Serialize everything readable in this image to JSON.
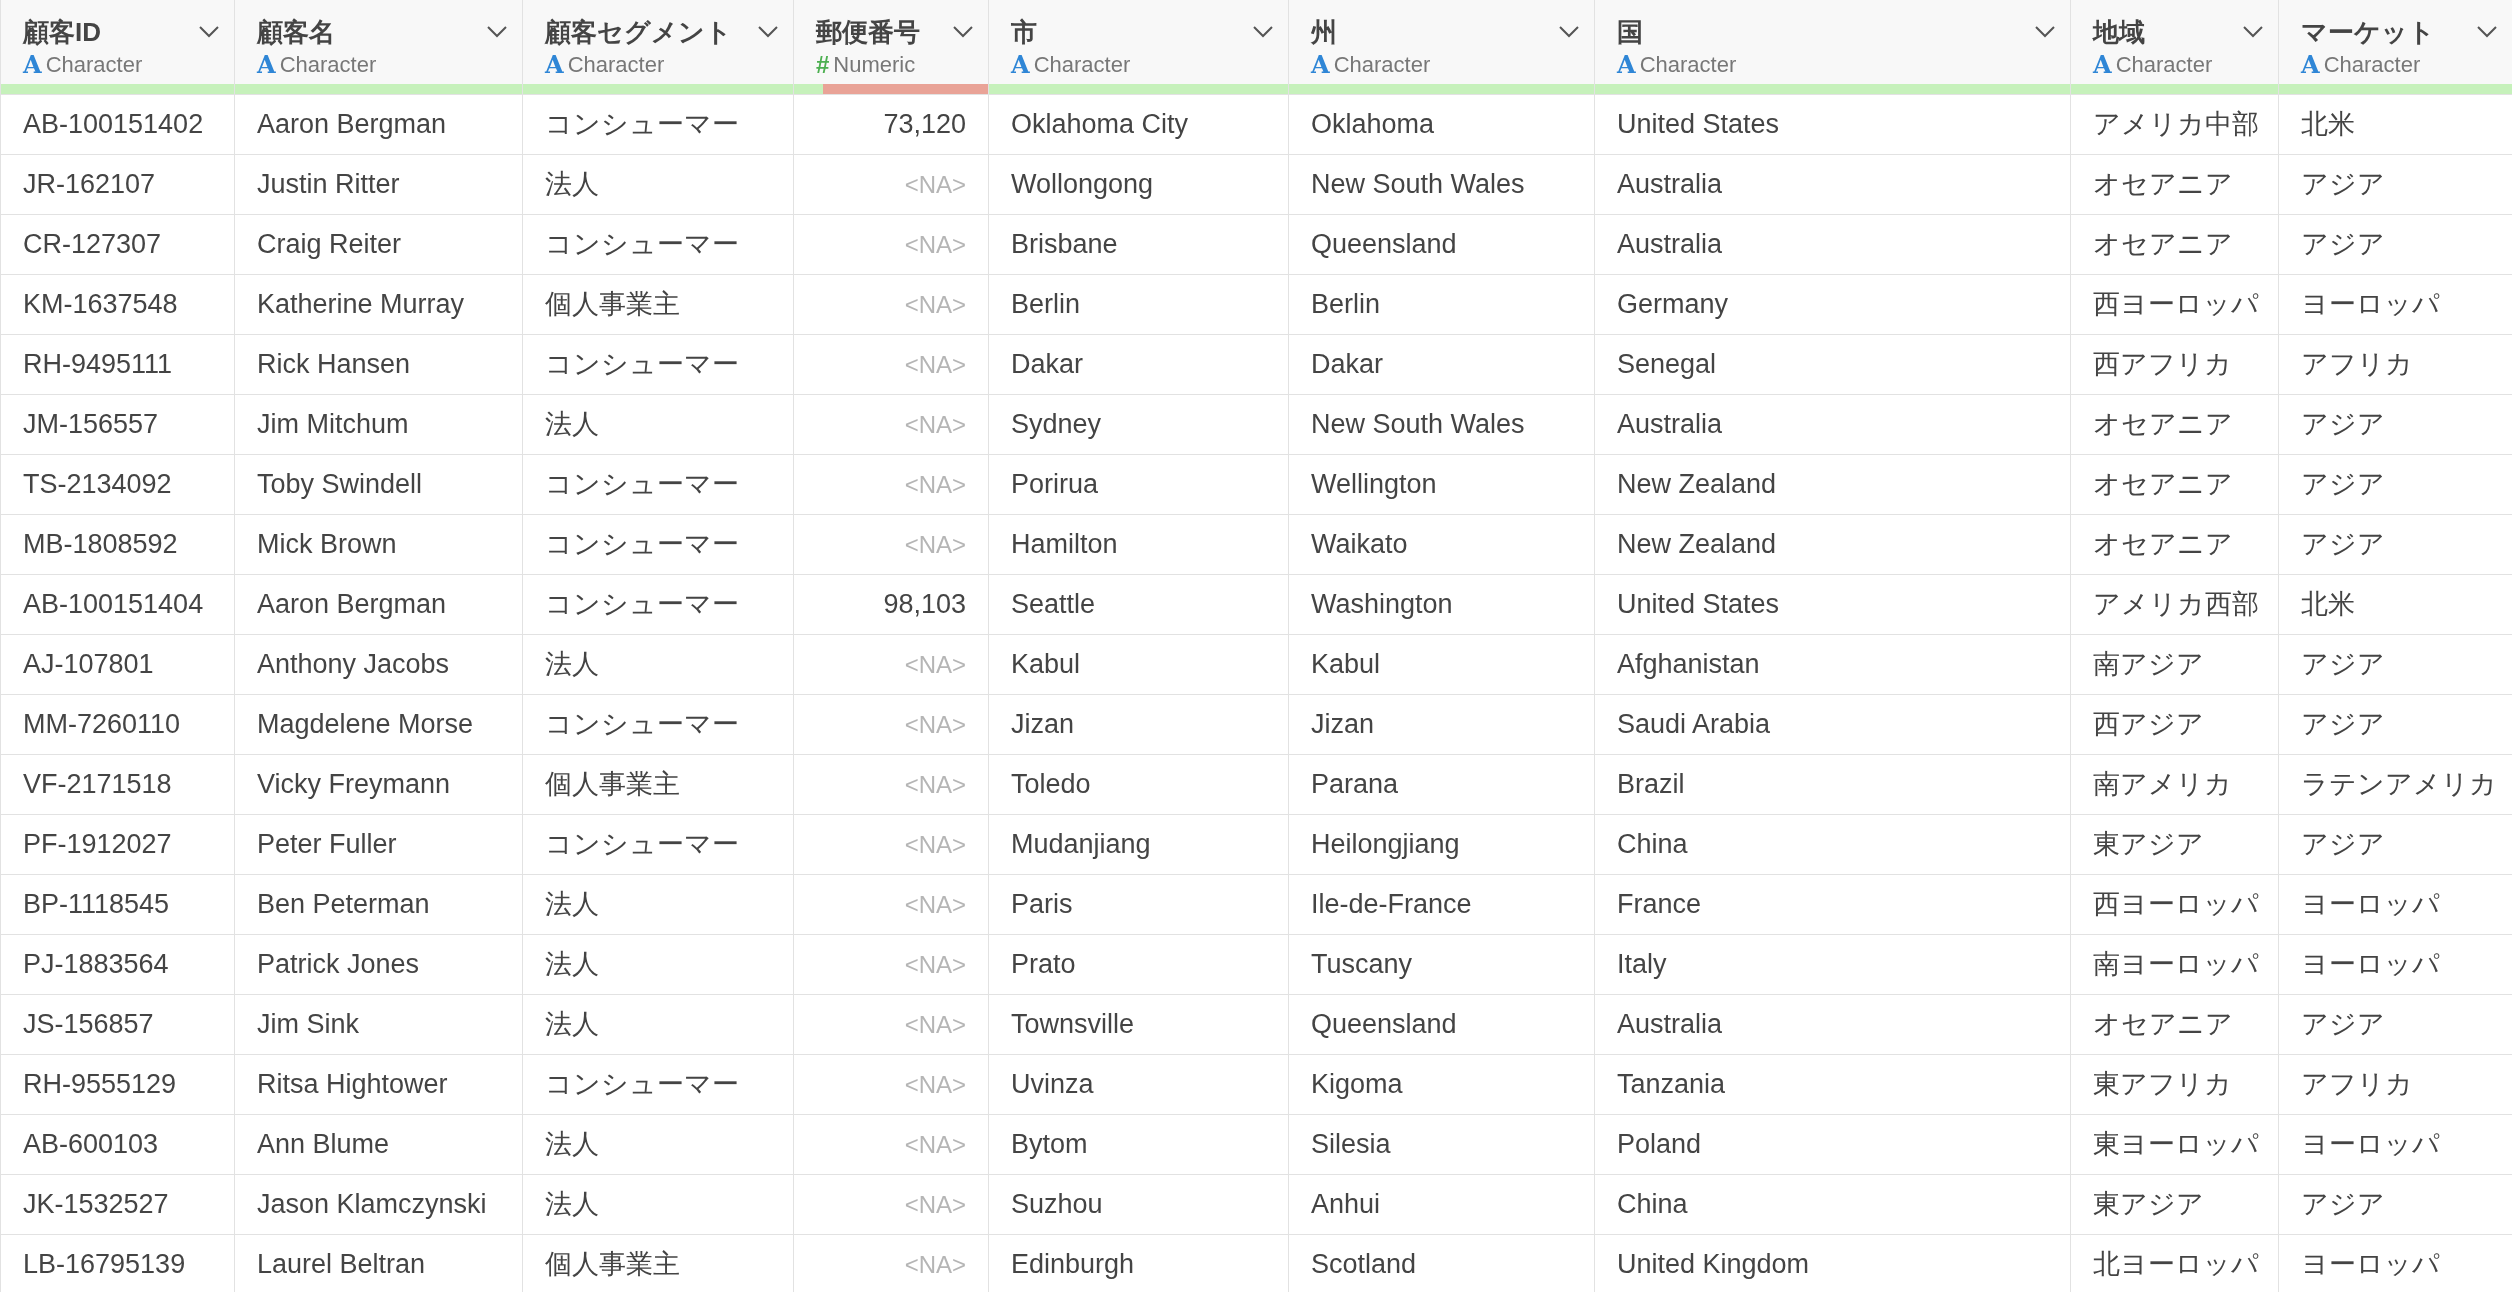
{
  "columns": [
    {
      "name": "顧客ID",
      "icon": "A",
      "kind": "character",
      "type_label": "Character",
      "level": 1
    },
    {
      "name": "顧客名",
      "icon": "A",
      "kind": "character",
      "type_label": "Character",
      "level": 1
    },
    {
      "name": "顧客セグメント",
      "icon": "A",
      "kind": "character",
      "type_label": "Character",
      "level": 1
    },
    {
      "name": "郵便番号",
      "icon": "#",
      "kind": "numeric",
      "type_label": "Numeric",
      "level": 0.15
    },
    {
      "name": "市",
      "icon": "A",
      "kind": "character",
      "type_label": "Character",
      "level": 1
    },
    {
      "name": "州",
      "icon": "A",
      "kind": "character",
      "type_label": "Character",
      "level": 1
    },
    {
      "name": "国",
      "icon": "A",
      "kind": "character",
      "type_label": "Character",
      "level": 1
    },
    {
      "name": "地域",
      "icon": "A",
      "kind": "character",
      "type_label": "Character",
      "level": 1
    },
    {
      "name": "マーケット",
      "icon": "A",
      "kind": "character",
      "type_label": "Character",
      "level": 1
    }
  ],
  "rows": [
    [
      "AB-100151402",
      "Aaron Bergman",
      "コンシューマー",
      "73,120",
      "Oklahoma City",
      "Oklahoma",
      "United States",
      "アメリカ中部",
      "北米"
    ],
    [
      "JR-162107",
      "Justin Ritter",
      "法人",
      {
        "text": "<NA>",
        "missing": true
      },
      "Wollongong",
      "New South Wales",
      "Australia",
      "オセアニア",
      "アジア"
    ],
    [
      "CR-127307",
      "Craig Reiter",
      "コンシューマー",
      {
        "text": "<NA>",
        "missing": true
      },
      "Brisbane",
      "Queensland",
      "Australia",
      "オセアニア",
      "アジア"
    ],
    [
      "KM-1637548",
      "Katherine Murray",
      "個人事業主",
      {
        "text": "<NA>",
        "missing": true
      },
      "Berlin",
      "Berlin",
      "Germany",
      "西ヨーロッパ",
      "ヨーロッパ"
    ],
    [
      "RH-9495111",
      "Rick Hansen",
      "コンシューマー",
      {
        "text": "<NA>",
        "missing": true
      },
      "Dakar",
      "Dakar",
      "Senegal",
      "西アフリカ",
      "アフリカ"
    ],
    [
      "JM-156557",
      "Jim Mitchum",
      "法人",
      {
        "text": "<NA>",
        "missing": true
      },
      "Sydney",
      "New South Wales",
      "Australia",
      "オセアニア",
      "アジア"
    ],
    [
      "TS-2134092",
      "Toby Swindell",
      "コンシューマー",
      {
        "text": "<NA>",
        "missing": true
      },
      "Porirua",
      "Wellington",
      "New Zealand",
      "オセアニア",
      "アジア"
    ],
    [
      "MB-1808592",
      "Mick Brown",
      "コンシューマー",
      {
        "text": "<NA>",
        "missing": true
      },
      "Hamilton",
      "Waikato",
      "New Zealand",
      "オセアニア",
      "アジア"
    ],
    [
      "AB-100151404",
      "Aaron Bergman",
      "コンシューマー",
      "98,103",
      "Seattle",
      "Washington",
      "United States",
      "アメリカ西部",
      "北米"
    ],
    [
      "AJ-107801",
      "Anthony Jacobs",
      "法人",
      {
        "text": "<NA>",
        "missing": true
      },
      "Kabul",
      "Kabul",
      "Afghanistan",
      "南アジア",
      "アジア"
    ],
    [
      "MM-7260110",
      "Magdelene Morse",
      "コンシューマー",
      {
        "text": "<NA>",
        "missing": true
      },
      "Jizan",
      "Jizan",
      "Saudi Arabia",
      "西アジア",
      "アジア"
    ],
    [
      "VF-2171518",
      "Vicky Freymann",
      "個人事業主",
      {
        "text": "<NA>",
        "missing": true
      },
      "Toledo",
      "Parana",
      "Brazil",
      "南アメリカ",
      "ラテンアメリカ"
    ],
    [
      "PF-1912027",
      "Peter Fuller",
      "コンシューマー",
      {
        "text": "<NA>",
        "missing": true
      },
      "Mudanjiang",
      "Heilongjiang",
      "China",
      "東アジア",
      "アジア"
    ],
    [
      "BP-1118545",
      "Ben Peterman",
      "法人",
      {
        "text": "<NA>",
        "missing": true
      },
      "Paris",
      "Ile-de-France",
      "France",
      "西ヨーロッパ",
      "ヨーロッパ"
    ],
    [
      "PJ-1883564",
      "Patrick Jones",
      "法人",
      {
        "text": "<NA>",
        "missing": true
      },
      "Prato",
      "Tuscany",
      "Italy",
      "南ヨーロッパ",
      "ヨーロッパ"
    ],
    [
      "JS-156857",
      "Jim Sink",
      "法人",
      {
        "text": "<NA>",
        "missing": true
      },
      "Townsville",
      "Queensland",
      "Australia",
      "オセアニア",
      "アジア"
    ],
    [
      "RH-9555129",
      "Ritsa Hightower",
      "コンシューマー",
      {
        "text": "<NA>",
        "missing": true
      },
      "Uvinza",
      "Kigoma",
      "Tanzania",
      "東アフリカ",
      "アフリカ"
    ],
    [
      "AB-600103",
      "Ann Blume",
      "法人",
      {
        "text": "<NA>",
        "missing": true
      },
      "Bytom",
      "Silesia",
      "Poland",
      "東ヨーロッパ",
      "ヨーロッパ"
    ],
    [
      "JK-1532527",
      "Jason Klamczynski",
      "法人",
      {
        "text": "<NA>",
        "missing": true
      },
      "Suzhou",
      "Anhui",
      "China",
      "東アジア",
      "アジア"
    ],
    [
      "LB-16795139",
      "Laurel Beltran",
      "個人事業主",
      {
        "text": "<NA>",
        "missing": true
      },
      "Edinburgh",
      "Scotland",
      "United Kingdom",
      "北ヨーロッパ",
      "ヨーロッパ"
    ]
  ]
}
